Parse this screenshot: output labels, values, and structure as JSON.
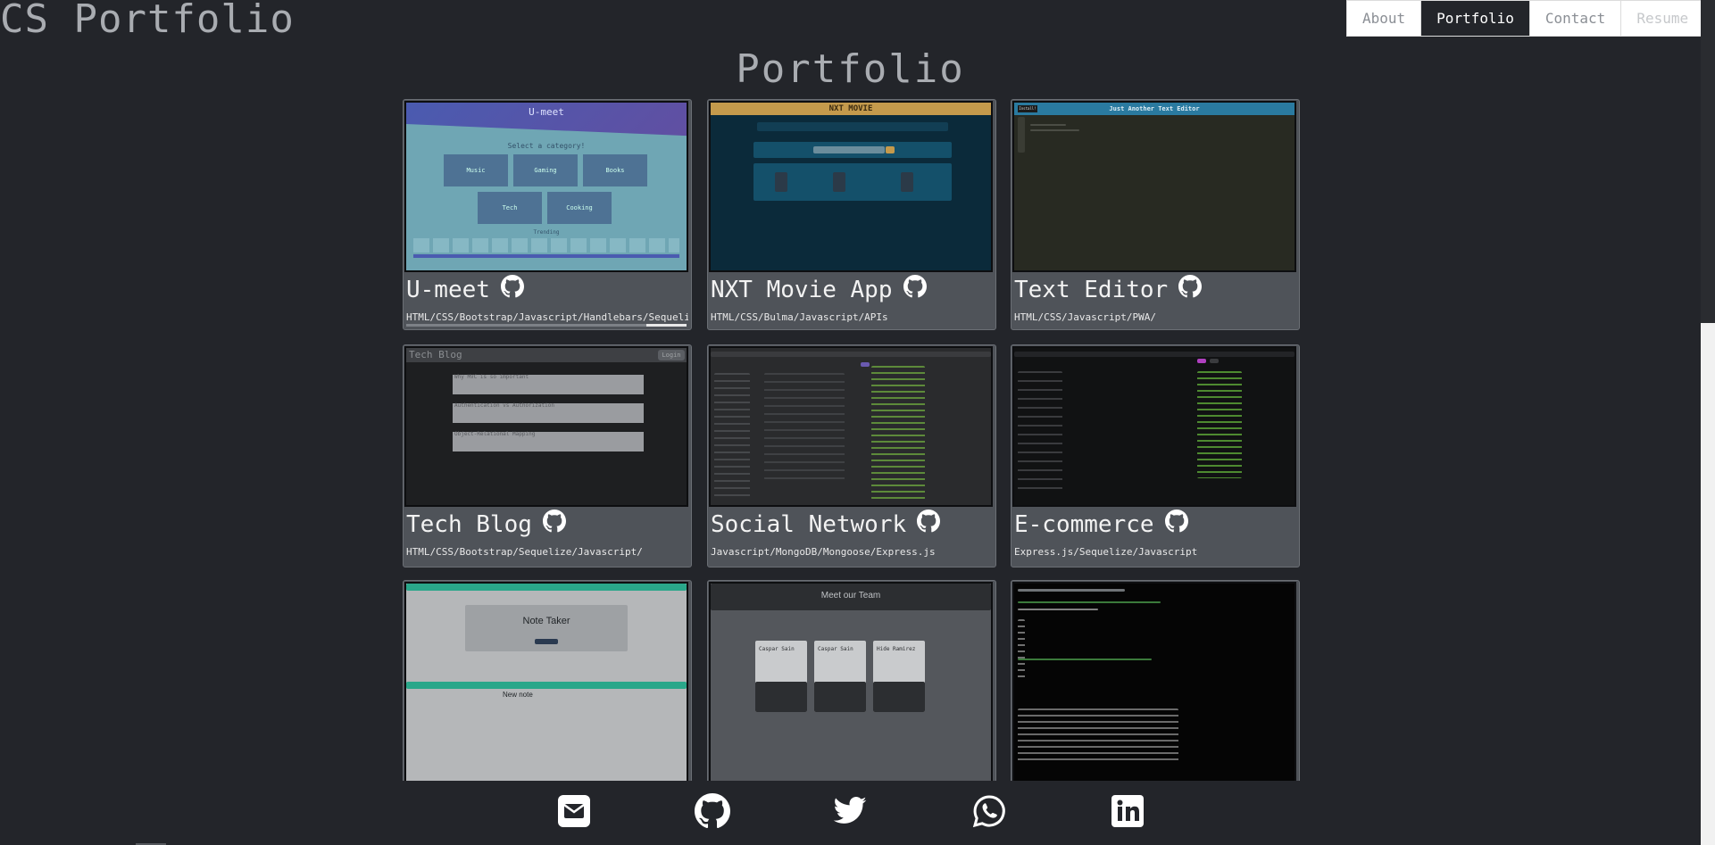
{
  "site_title": "CS Portfolio",
  "nav": [
    {
      "label": "About",
      "active": false
    },
    {
      "label": "Portfolio",
      "active": true
    },
    {
      "label": "Contact",
      "active": false
    },
    {
      "label": "Resume",
      "active": false
    }
  ],
  "page_heading": "Portfolio",
  "projects": [
    {
      "title": "U-meet",
      "tech": "HTML/CSS/Bootstrap/Javascript/Handlebars/Sequelize/Node",
      "icon": "github-icon",
      "thumb": {
        "header_text": "U-meet",
        "select_text": "Select a category!",
        "categories": [
          "Music",
          "Gaming",
          "Books",
          "Tech",
          "Cooking"
        ],
        "footer_text": "Trending"
      }
    },
    {
      "title": "NXT Movie App",
      "tech": "HTML/CSS/Bulma/Javascript/APIs",
      "icon": "github-icon",
      "thumb": {
        "header_text": "NXT MOVIE"
      }
    },
    {
      "title": "Text Editor",
      "tech": "HTML/CSS/Javascript/PWA/",
      "icon": "github-icon",
      "thumb": {
        "header_text": "Just Another Text Editor",
        "button_text": "Install!"
      }
    },
    {
      "title": "Tech Blog",
      "tech": "HTML/CSS/Bootstrap/Sequelize/Javascript/",
      "icon": "github-icon",
      "thumb": {
        "header_text": "Tech Blog",
        "login_text": "Login",
        "posts": [
          "Why MVC is so important",
          "Authentication vs Authorization",
          "Object-Relational Mapping"
        ]
      }
    },
    {
      "title": "Social Network",
      "tech": "Javascript/MongoDB/Mongoose/Express.js",
      "icon": "github-icon",
      "thumb": {}
    },
    {
      "title": "E-commerce",
      "tech": "Express.js/Sequelize/Javascript",
      "icon": "github-icon",
      "thumb": {}
    },
    {
      "title": "",
      "tech": "",
      "icon": "",
      "thumb": {
        "app_title": "Note Taker",
        "note_title": "New note"
      }
    },
    {
      "title": "",
      "tech": "",
      "icon": "",
      "thumb": {
        "header_text": "Meet our Team",
        "cards": [
          "Caspar Sain",
          "Caspar Sain",
          "Hide Ramirez"
        ]
      }
    },
    {
      "title": "",
      "tech": "",
      "icon": "",
      "thumb": {}
    }
  ],
  "footer_icons": [
    "email-icon",
    "github-icon",
    "twitter-icon",
    "whatsapp-icon",
    "linkedin-icon"
  ],
  "colors": {
    "background": "#23252a",
    "card": "#4f5359",
    "nav_active": "#23252a"
  }
}
